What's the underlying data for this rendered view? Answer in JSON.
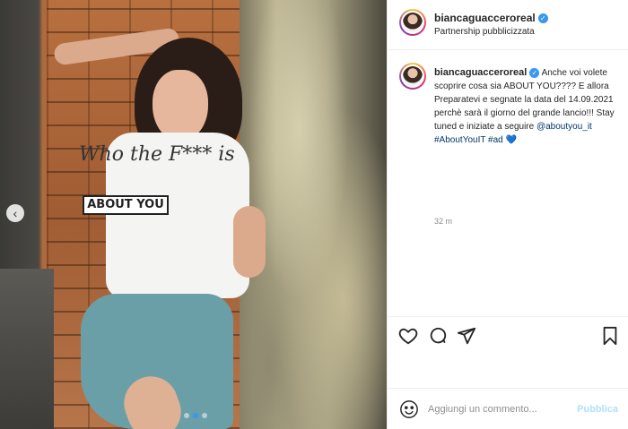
{
  "post": {
    "username": "biancaguacceroreal",
    "verified_glyph": "✓",
    "subtitle": "Partnership pubblicizzata",
    "caption_text": "Anche voi volete scoprire cosa sia ABOUT YOU???? E allora Preparatevi e segnate la data del 14.09.2021 perchè sarà il giorno del grande lancio!!! Stay tuned e iniziate a seguire ",
    "mention": "@aboutyou_it",
    "hashtags": "#AboutYouIT #ad",
    "heart_emoji": "💙",
    "time_ago": "32 m"
  },
  "photo": {
    "tshirt_text": "ABOUT YOU",
    "scribble_text": "Who the F*** is",
    "carousel_prev_glyph": "‹"
  },
  "comment": {
    "placeholder": "Aggiungi un commento...",
    "publish_label": "Pubblica"
  },
  "icons": [
    "heart-icon",
    "comment-icon",
    "share-icon",
    "bookmark-icon",
    "emoji-icon",
    "verified-icon",
    "chevron-left-icon"
  ],
  "colors": {
    "accent": "#3897f0",
    "publish_disabled": "#b2dffc",
    "muted": "#8e8e8e"
  }
}
